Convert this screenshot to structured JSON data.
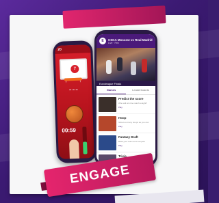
{
  "header_ribbon": {
    "label": ""
  },
  "left_phone": {
    "status_time": "20",
    "logo_text": "7",
    "timer": "00:59",
    "time_remaining_fraction": 0.45
  },
  "right_phone": {
    "title": "CSKA Moscow vs Real Madrid",
    "subtitle": "Live  ·  Feb",
    "subbar_label": "Euroleague Finals",
    "tabs": [
      {
        "label": "Games",
        "active": true
      },
      {
        "label": "Leaderboards",
        "active": false
      }
    ],
    "feed": [
      {
        "title": "Predict the score",
        "sub": "Who will win the match tonight?",
        "tag": "Play",
        "thumb_color": "#3a2f2a"
      },
      {
        "title": "Hoop",
        "sub": "Shoot as many hoops as you can",
        "tag": "Play",
        "thumb_color": "#b5472b"
      },
      {
        "title": "Fantasy Draft",
        "sub": "Build your team and compete",
        "tag": "Play",
        "thumb_color": "#2b4a8a"
      },
      {
        "title": "Trivia",
        "sub": "",
        "tag": "",
        "thumb_color": "#5a4a6a"
      }
    ]
  },
  "engage_ribbon": {
    "label": "ENGAGE"
  },
  "colors": {
    "brand_purple": "#4b1a7a",
    "ribbon_pink": "#e5256d",
    "hoop_red": "#d81f2b"
  }
}
